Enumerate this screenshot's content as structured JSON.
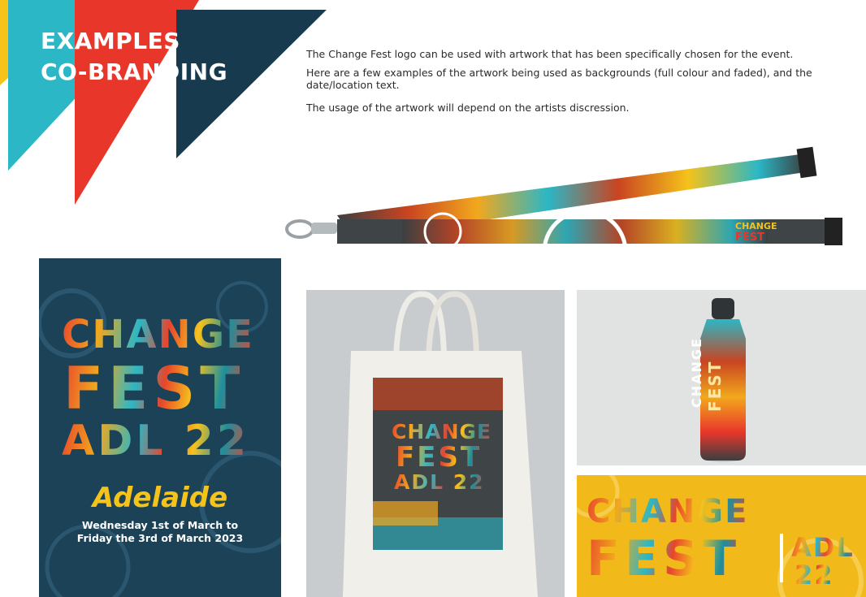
{
  "header": {
    "title_line1": "EXAMPLES",
    "title_line2": "CO-BRANDING"
  },
  "description": {
    "para1": "The Change Fest logo can be used with artwork that has been specifically chosen for the event.",
    "para2": "Here are a few examples of the artwork being used as backgrounds (full colour and faded), and the date/location text.",
    "para3": "The usage of the artwork will depend on the artists discression."
  },
  "logo": {
    "word1": "CHANGE",
    "word2": "FEST",
    "word3": "ADL 22",
    "word3_a": "ADL",
    "word3_b": "22"
  },
  "poster": {
    "city": "Adelaide",
    "date_line1": "Wednesday 1st of March to",
    "date_line2": "Friday the 3rd of March 2023"
  },
  "colors": {
    "navy": "#173a4f",
    "teal": "#2bb7c6",
    "red": "#e8362a",
    "yellow": "#f5c31a",
    "orange": "#e8672c",
    "poster_bg": "#1b4257",
    "banner_bg": "#f2b91a"
  }
}
